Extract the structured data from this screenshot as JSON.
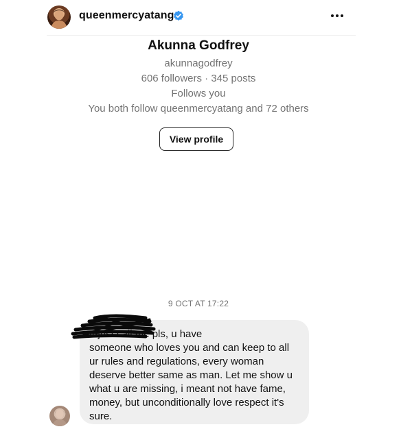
{
  "header": {
    "username": "queenmercyatang",
    "verified_icon": "verified-badge-icon",
    "more_icon": "more-options-icon",
    "accent_color": "#3897f0"
  },
  "profile": {
    "name": "Akunna Godfrey",
    "handle": "akunnagodfrey",
    "stats": "606 followers · 345 posts",
    "follows_status": "Follows you",
    "mutual": "You both follow queenmercyatang and 72 others",
    "view_profile_label": "View profile"
  },
  "conversation": {
    "timestamp": "9 OCT AT 17:22",
    "messages": [
      {
        "text": "4 just call me pls, u have\nsomeone who loves you and can keep to all\nur rules and regulations, every woman\ndeserve better same as man. Let me show u\nwhat u are missing, i meant not have fame,\nmoney, but unconditionally love respect it's\nsure.",
        "redacted_prefix": true
      }
    ]
  },
  "colors": {
    "bubble": "#efefef",
    "muted_text": "#737373",
    "primary_text": "#111111"
  }
}
